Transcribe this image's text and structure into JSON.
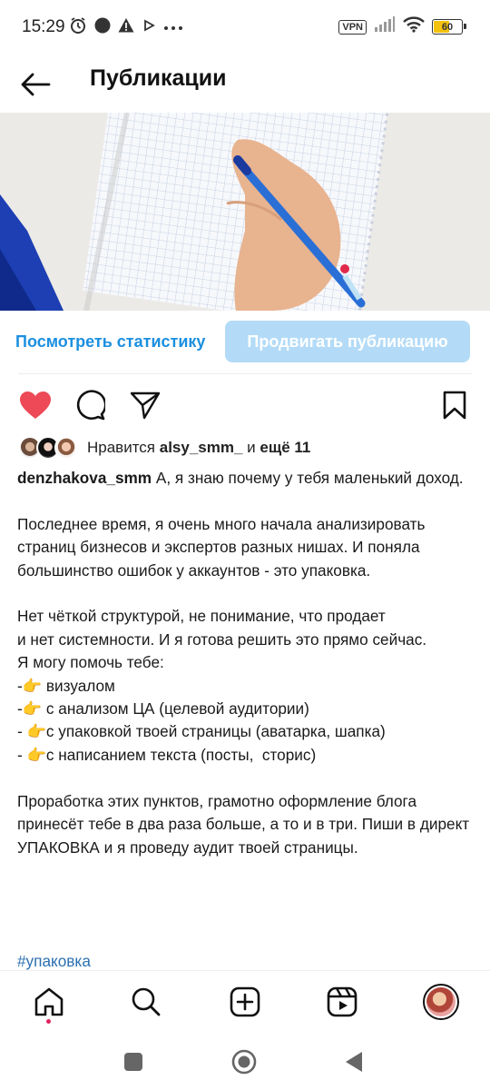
{
  "status_bar": {
    "time": "15:29",
    "vpn": "VPN",
    "battery_level": "60",
    "battery_fraction": 0.6
  },
  "header": {
    "title": "Публикации",
    "back_icon": "arrow-left-icon"
  },
  "post": {
    "stats_link": "Посмотреть статистику",
    "promote_button": "Продвигать публикацию",
    "likes": {
      "prefix": "Нравится ",
      "user": "alsy_smm_",
      "middle": " и ",
      "more": "ещё 11"
    },
    "caption": {
      "author": "denzhakova_smm",
      "text": " А, я знаю почему у тебя маленький доход.\n\nПоследнее время, я очень много начала анализировать страниц бизнесов и экспертов разных нишах. И поняла большинство ошибок у аккаунтов - это упаковка.\n\nНет чёткой структурой, не понимание, что продает\nи нет системности. И я готова решить это прямо сейчас.\nЯ могу помочь тебе:\n-👉 визуалом\n-👉 с анализом ЦА (целевой аудитории)\n- 👉с упаковкой твоей страницы (аватарка, шапка)\n- 👉с написанием текста (посты,  сторис)\n\nПроработка этих пунктов, грамотно оформление блога принесёт тебе в два раза больше, а то и в три. Пиши в директ УПАКОВКА и я проведу аудит твоей страницы."
    },
    "hashtag": "#упаковка",
    "liked": true,
    "like_color": "#ed4956",
    "accent_color": "#1b8fe0"
  },
  "bottom_nav": [
    "home-icon",
    "search-icon",
    "add-post-icon",
    "reels-icon",
    "profile-avatar"
  ],
  "system_nav": [
    "recents-icon",
    "home-circle-icon",
    "back-triangle-icon"
  ]
}
